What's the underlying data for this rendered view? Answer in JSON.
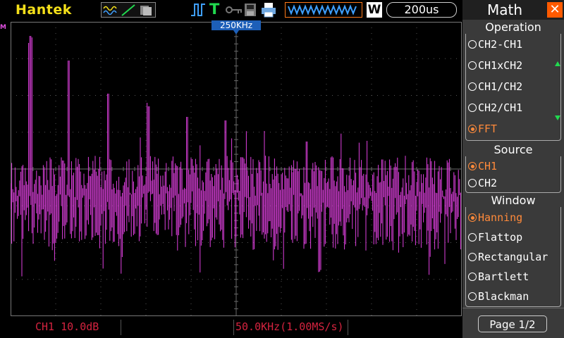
{
  "header": {
    "brand": "Hantek",
    "memory_depth_icon": "waveform-memory-icon",
    "w_badge": "W",
    "timebase": "200us"
  },
  "plot": {
    "channel_marker": "M",
    "freq_marker": "250KHz",
    "trace_color": "#e040e0"
  },
  "status": {
    "ch1": "CH1 10.0dB",
    "freq": "50.0KHz(1.00MS/s)"
  },
  "menu": {
    "title": "Math",
    "close_icon": "close-icon",
    "operation": {
      "title": "Operation",
      "options": [
        "CH2-CH1",
        "CH1xCH2",
        "CH1/CH2",
        "CH2/CH1",
        "FFT"
      ],
      "selected": "FFT"
    },
    "source": {
      "title": "Source",
      "options": [
        "CH1",
        "CH2"
      ],
      "selected": "CH1"
    },
    "window": {
      "title": "Window",
      "options": [
        "Hanning",
        "Flattop",
        "Rectangular",
        "Bartlett",
        "Blackman"
      ],
      "selected": "Hanning"
    },
    "page": "Page 1/2"
  },
  "colors": {
    "brand": "#f5e01a",
    "accent": "#ff8a3a",
    "status_text": "#d4233f",
    "trace": "#e040e0"
  }
}
